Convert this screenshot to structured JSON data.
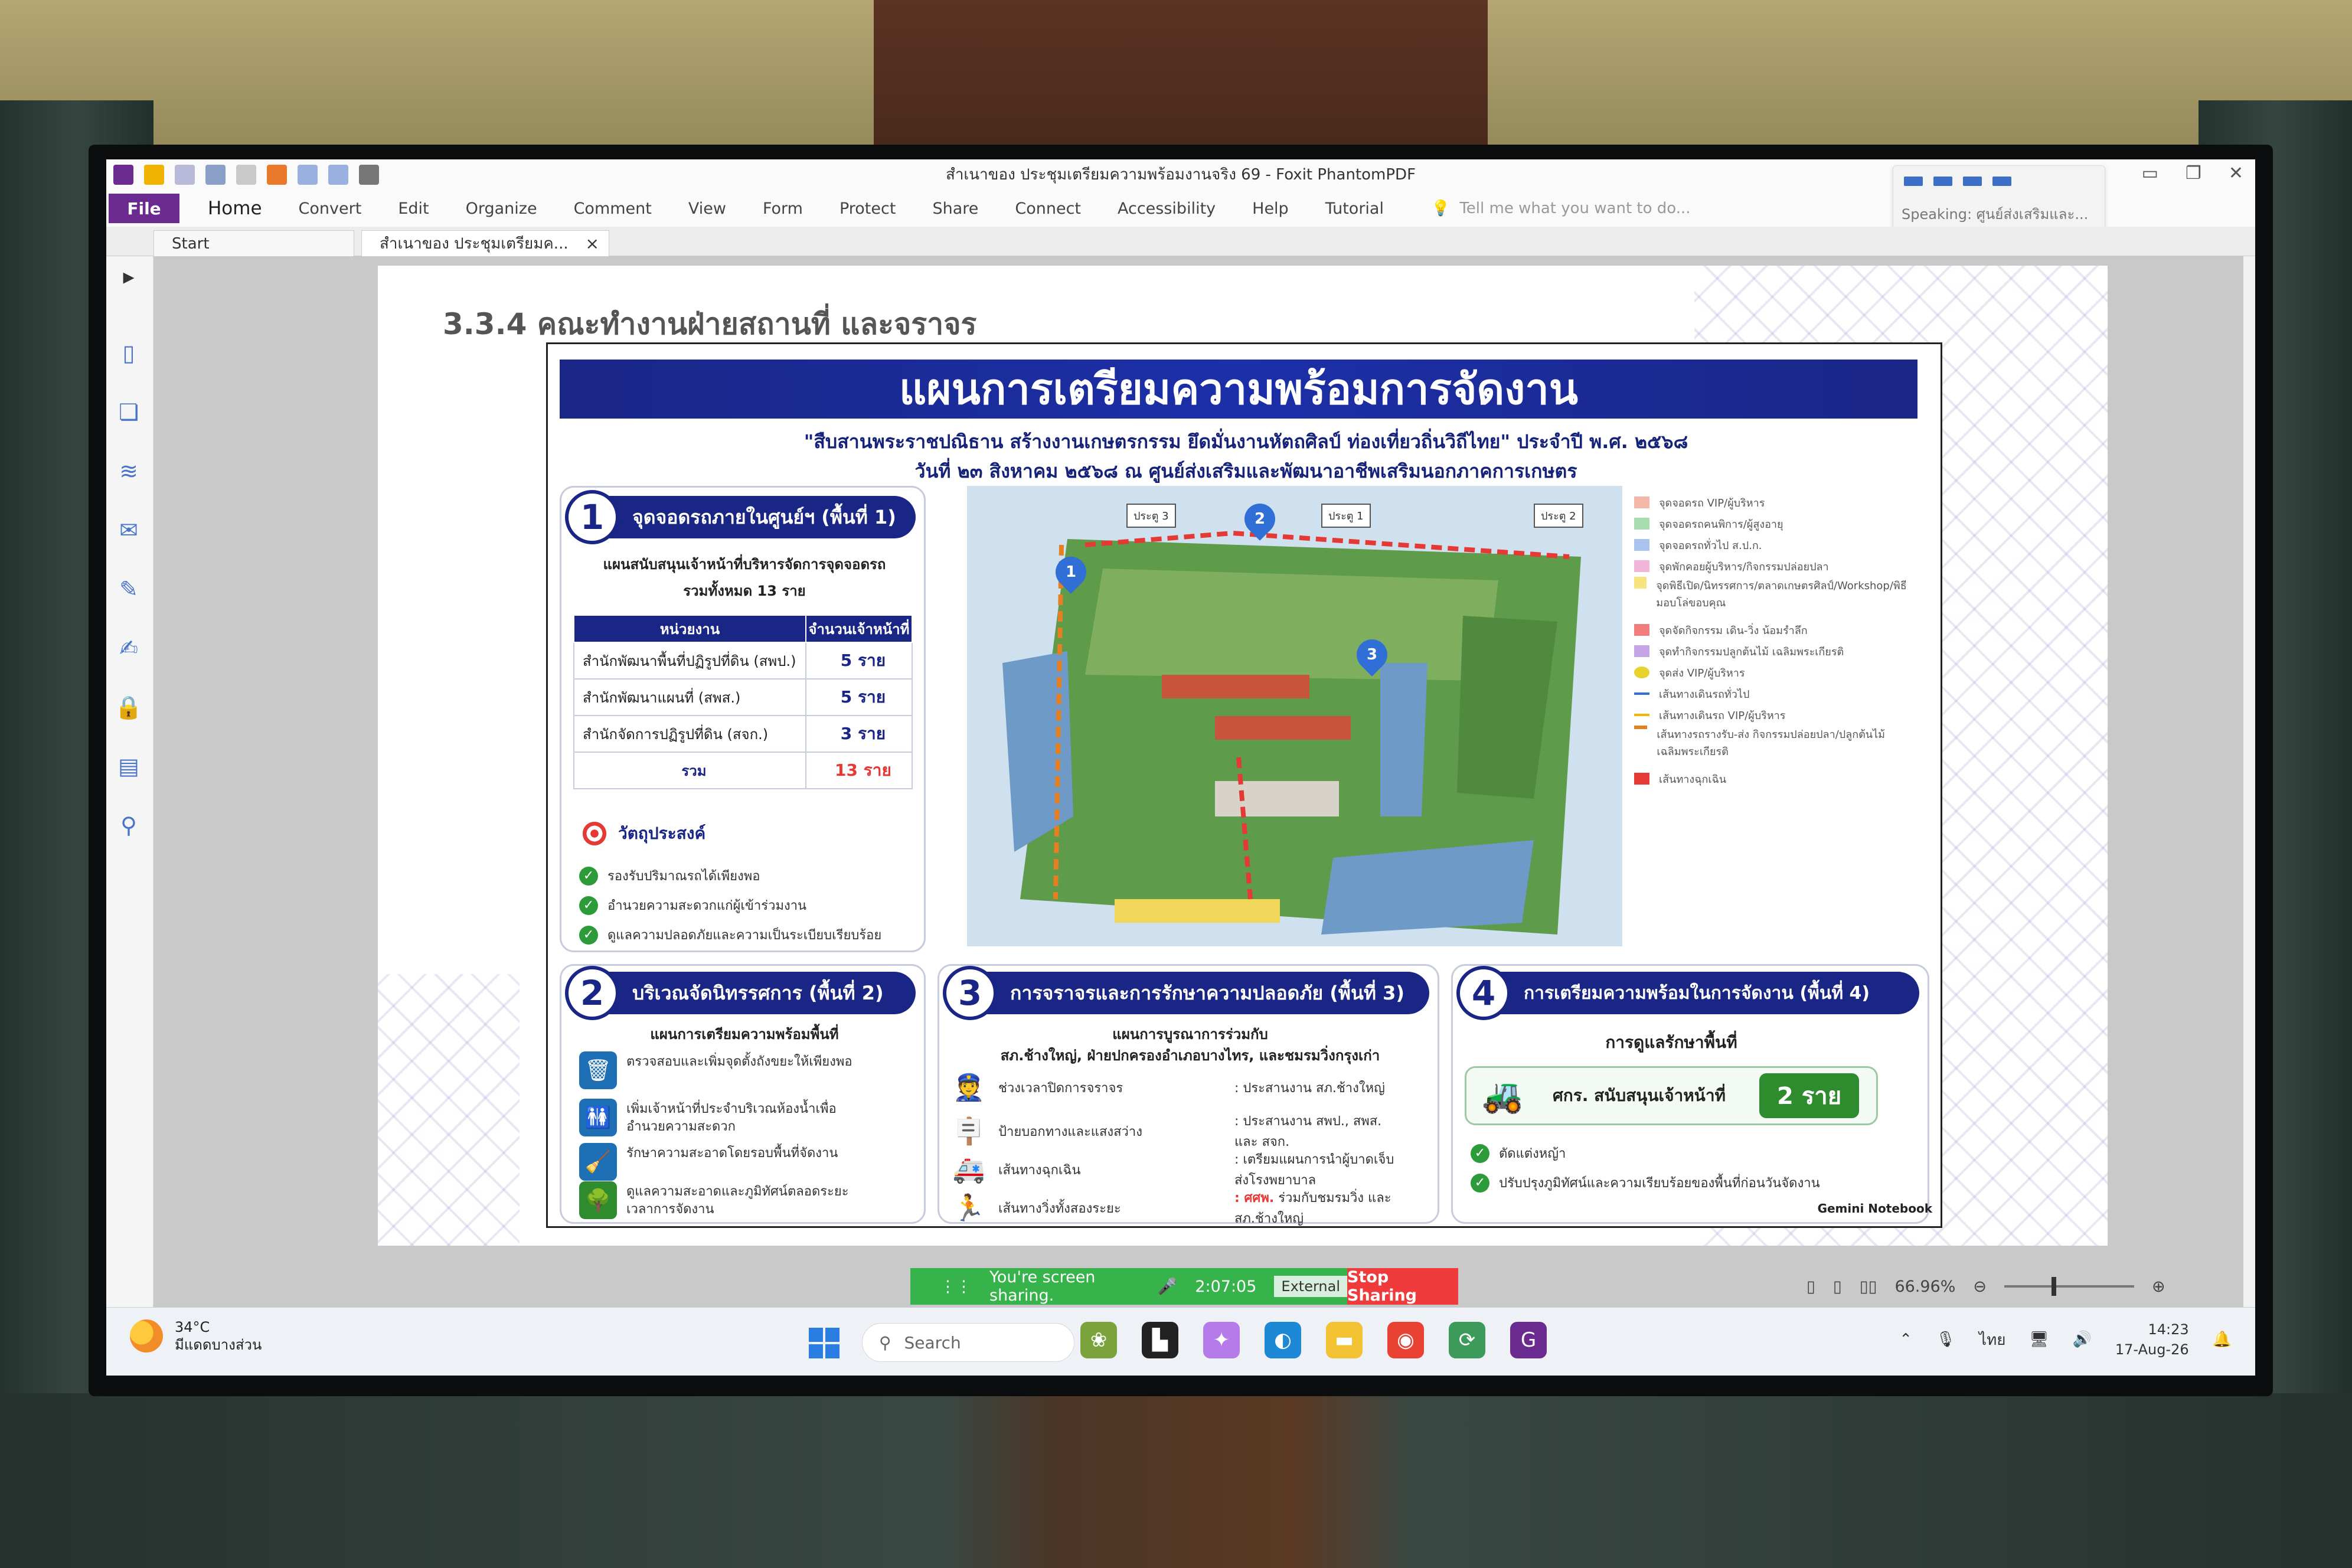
{
  "window": {
    "title": "สำเนาของ ประชุมเตรียมความพร้อมงานจริง 69 - Foxit PhantomPDF"
  },
  "menu": {
    "file": "File",
    "items": [
      "Home",
      "Convert",
      "Edit",
      "Organize",
      "Comment",
      "View",
      "Form",
      "Protect",
      "Share",
      "Connect",
      "Accessibility",
      "Help",
      "Tutorial"
    ],
    "tell_me": "Tell me what you want to do..."
  },
  "speaking": {
    "label": "Speaking: ศูนย์ส่งเสริมและ..."
  },
  "tabs": [
    {
      "label": "Start"
    },
    {
      "label": "สำเนาของ ประชุมเตรียมค...",
      "close": "×"
    }
  ],
  "document": {
    "section_heading": "3.3.4 คณะทำงานฝ่ายสถานที่ และจราจร",
    "banner": "แผนการเตรียมความพร้อมการจัดงาน",
    "subtitle_1": "\"สืบสานพระราชปณิธาน สร้างงานเกษตรกรรม ยึดมั่นงานหัตถศิลป์ ท่องเที่ยวถิ่นวิถีไทย\" ประจำปี พ.ศ. ๒๕๖๘",
    "subtitle_2": "วันที่ ๒๓ สิงหาคม ๒๕๖๘ ณ ศูนย์ส่งเสริมและพัฒนาอาชีพเสริมนอกภาคการเกษตร",
    "panel1": {
      "number": "1",
      "title": "จุดจอดรถภายในศูนย์ฯ (พื้นที่ 1)",
      "caption": "แผนสนับสนุนเจ้าหน้าที่บริหารจัดการจุดจอดรถ",
      "caption_total": "รวมทั้งหมด 13 ราย",
      "table_headers": [
        "หน่วยงาน",
        "จำนวนเจ้าหน้าที่"
      ],
      "rows": [
        {
          "unit": "สำนักพัฒนาพื้นที่ปฏิรูปที่ดิน (สพป.)",
          "count": "5 ราย"
        },
        {
          "unit": "สำนักพัฒนาแผนที่ (สพส.)",
          "count": "5 ราย"
        },
        {
          "unit": "สำนักจัดการปฏิรูปที่ดิน (สจก.)",
          "count": "3 ราย"
        }
      ],
      "total_label": "รวม",
      "total_count": "13 ราย",
      "objective_title": "วัตถุประสงค์",
      "objectives": [
        "รองรับปริมาณรถได้เพียงพอ",
        "อำนวยความสะดวกแก่ผู้เข้าร่วมงาน",
        "ดูแลความปลอดภัยและความเป็นระเบียบเรียบร้อย"
      ]
    },
    "map": {
      "gates": [
        "ประตู 3",
        "ประตู 1",
        "ประตู 2"
      ],
      "pins": [
        "1",
        "2",
        "3"
      ],
      "legend": [
        {
          "label": "จุดจอดรถ VIP/ผู้บริหาร",
          "color": "#f4b6a6"
        },
        {
          "label": "จุดจอดรถคนพิการ/ผู้สูงอายุ",
          "color": "#a7dcae"
        },
        {
          "label": "จุดจอดรถทั่วไป ส.ป.ก.",
          "color": "#a9c3ec"
        },
        {
          "label": "จุดพักคอยผู้บริหาร/กิจกรรมปล่อยปลา",
          "color": "#f2b6d9"
        },
        {
          "label": "จุดพิธีเปิด/นิทรรศการ/ตลาดเกษตรศิลป์/Workshop/พิธีมอบโล่ขอบคุณ",
          "color": "#f6e27f"
        },
        {
          "label": "จุดจัดกิจกรรม เดิน-วิ่ง น้อมรำลึก",
          "color": "#f17d7d"
        },
        {
          "label": "จุดทำกิจกรรมปลูกต้นไม้ เฉลิมพระเกียรติ",
          "color": "#c7a6e6"
        },
        {
          "label": "จุดส่ง VIP/ผู้บริหาร",
          "color": "#e8d22c"
        },
        {
          "label": "เส้นทางเดินรถทั่วไป",
          "color": "#2f6fd6"
        },
        {
          "label": "เส้นทางเดินรถ VIP/ผู้บริหาร",
          "color": "#f4b400"
        },
        {
          "label": "เส้นทางรถรางรับ-ส่ง กิจกรรมปล่อยปลา/ปลูกต้นไม้ เฉลิมพระเกียรติ",
          "color": "#e67e22"
        },
        {
          "label": "เส้นทางฉุกเฉิน",
          "color": "#e53935"
        }
      ]
    },
    "panel2": {
      "number": "2",
      "title": "บริเวณจัดนิทรรศการ (พื้นที่ 2)",
      "caption": "แผนการเตรียมความพร้อมพื้นที่",
      "items": [
        {
          "icon": "trash-icon",
          "text": "ตรวจสอบและเพิ่มจุดตั้งถังขยะให้เพียงพอ"
        },
        {
          "icon": "restroom-icon",
          "text": "เพิ่มเจ้าหน้าที่ประจำบริเวณห้องน้ำเพื่ออำนวยความสะดวก"
        },
        {
          "icon": "broom-icon",
          "text": "รักษาความสะอาดโดยรอบพื้นที่จัดงาน"
        },
        {
          "icon": "tree-icon",
          "text": "ดูแลความสะอาดและภูมิทัศน์ตลอดระยะเวลาการจัดงาน"
        }
      ]
    },
    "panel3": {
      "number": "3",
      "title": "การจราจรและการรักษาความปลอดภัย (พื้นที่ 3)",
      "caption_1": "แผนการบูรณาการร่วมกับ",
      "caption_2": "สภ.ช้างใหญ่, ฝ่ายปกครองอำเภอบางไทร, และชมรมวิ่งกรุงเก่า",
      "rows": [
        {
          "icon": "police-icon",
          "left": "ช่วงเวลาปิดการจราจร",
          "right_prefix": "",
          "right": ": ประสานงาน สภ.ช้างใหญ่"
        },
        {
          "icon": "signpost-icon",
          "left": "ป้ายบอกทางและแสงสว่าง",
          "right_prefix": "",
          "right": ": ประสานงาน สพป., สพส. และ สจก."
        },
        {
          "icon": "ambulance-icon",
          "left": "เส้นทางฉุกเฉิน",
          "right_prefix": "",
          "right": ": เตรียมแผนการนำผู้บาดเจ็บส่งโรงพยาบาล"
        },
        {
          "icon": "runner-icon",
          "left": "เส้นทางวิ่งทั้งสองระยะ",
          "right_prefix": ": ศศพ.",
          "right": " ร่วมกับชมรมวิ่ง และ สภ.ช้างใหญ่"
        }
      ]
    },
    "panel4": {
      "number": "4",
      "title": "การเตรียมความพร้อมในการจัดงาน (พื้นที่ 4)",
      "caption": "การดูแลรักษาพื้นที่",
      "support_label": "ศกร. สนับสนุนเจ้าหน้าที่",
      "support_count": "2 ราย",
      "items": [
        "ตัดแต่งหญ้า",
        "ปรับปรุงภูมิทัศน์และความเรียบร้อยของพื้นที่ก่อนวันจัดงาน"
      ]
    },
    "watermark": "Gemini Notebook"
  },
  "sharing": {
    "status": "You're screen sharing.",
    "timer": "2:07:05",
    "external": "External",
    "stop": "Stop Sharing"
  },
  "status": {
    "zoom": "66.96%"
  },
  "taskbar": {
    "temperature": "34°C",
    "weather": "มีแดดบางส่วน",
    "search": "Search",
    "language": "ไทย",
    "time": "14:23",
    "date": "17-Aug-26"
  }
}
